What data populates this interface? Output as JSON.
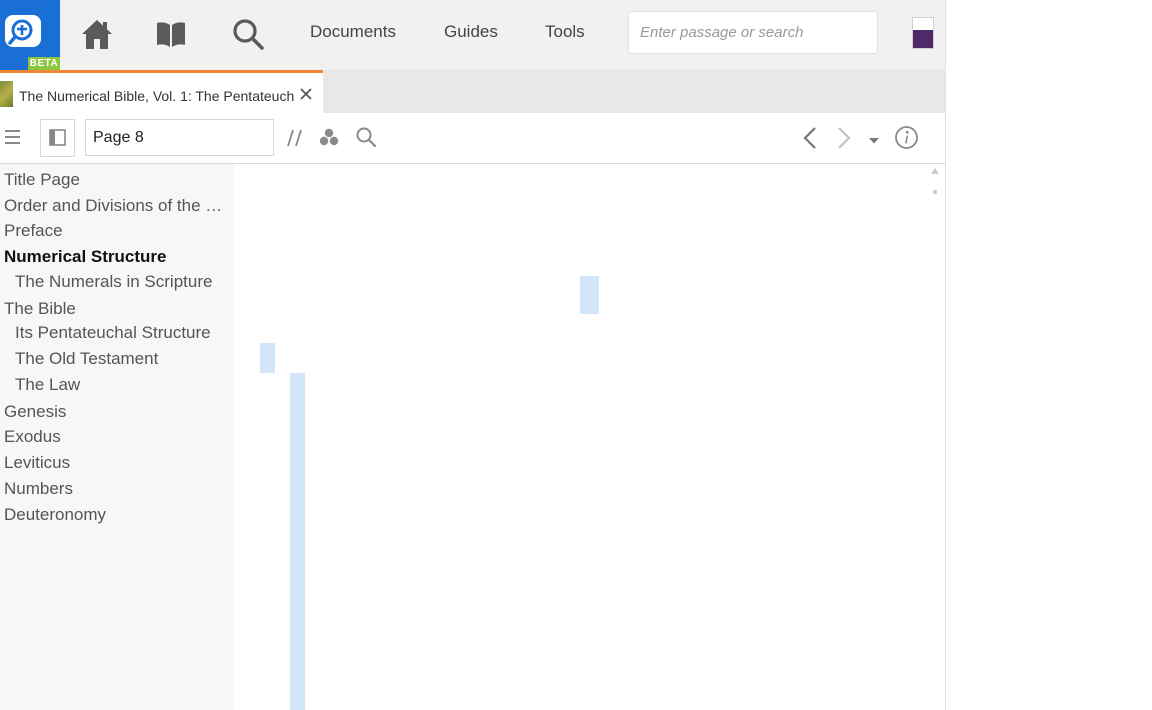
{
  "topbar": {
    "beta_label": "BETA",
    "nav": {
      "documents": "Documents",
      "guides": "Guides",
      "tools": "Tools"
    },
    "search": {
      "placeholder": "Enter passage or search",
      "value": ""
    },
    "colors": {
      "brand_blue": "#1a6fd4",
      "beta_green": "#8cc63f",
      "tab_accent": "#f08536",
      "highlight": "#d3e5f9"
    },
    "icons": [
      "logos-logo-icon",
      "home-icon",
      "library-book-icon",
      "search-icon"
    ]
  },
  "tab": {
    "title": "The Numerical Bible, Vol. 1: The Pentateuch"
  },
  "toolbar": {
    "reference_value": "Page 8",
    "icons": [
      "hamburger-menu-icon",
      "sidebar-toggle-icon",
      "parallel-resources-icon",
      "visual-filters-icon",
      "search-icon",
      "back-arrow-icon",
      "forward-arrow-icon",
      "dropdown-caret-icon",
      "info-icon"
    ]
  },
  "toc": {
    "items": [
      {
        "label": "Title Page"
      },
      {
        "label": "Order and Divisions of the Books"
      },
      {
        "label": "Preface"
      },
      {
        "label": "Numerical Structure"
      },
      {
        "label": "The Numerals in Scripture"
      },
      {
        "label": "The Bible"
      },
      {
        "label": "Its Pentateuchal Structure"
      },
      {
        "label": "The Old Testament"
      },
      {
        "label": "The Law"
      },
      {
        "label": "Genesis"
      },
      {
        "label": "Exodus"
      },
      {
        "label": "Leviticus"
      },
      {
        "label": "Numbers"
      },
      {
        "label": "Deuteronomy"
      }
    ]
  }
}
